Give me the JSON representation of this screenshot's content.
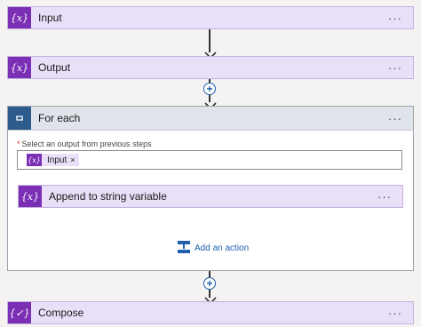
{
  "steps": {
    "input": {
      "title": "Input",
      "icon": "variable-icon",
      "more": "···"
    },
    "output": {
      "title": "Output",
      "icon": "variable-icon",
      "more": "···"
    },
    "compose": {
      "title": "Compose",
      "icon": "compose-icon",
      "more": "···"
    }
  },
  "foreach": {
    "title": "For each",
    "icon": "loop-icon",
    "more": "···",
    "field_required_marker": "*",
    "field_label": "Select an output from previous steps",
    "token": {
      "label": "Input",
      "remove": "×",
      "icon": "variable-icon"
    },
    "inner_action": {
      "title": "Append to string variable",
      "icon": "variable-icon",
      "more": "···"
    },
    "add_action_label": "Add an action"
  },
  "colors": {
    "variable_accent": "#7b2fb5",
    "variable_bg": "#eadff8",
    "loop_accent": "#2d5b8c",
    "link_blue": "#1f5fae"
  }
}
